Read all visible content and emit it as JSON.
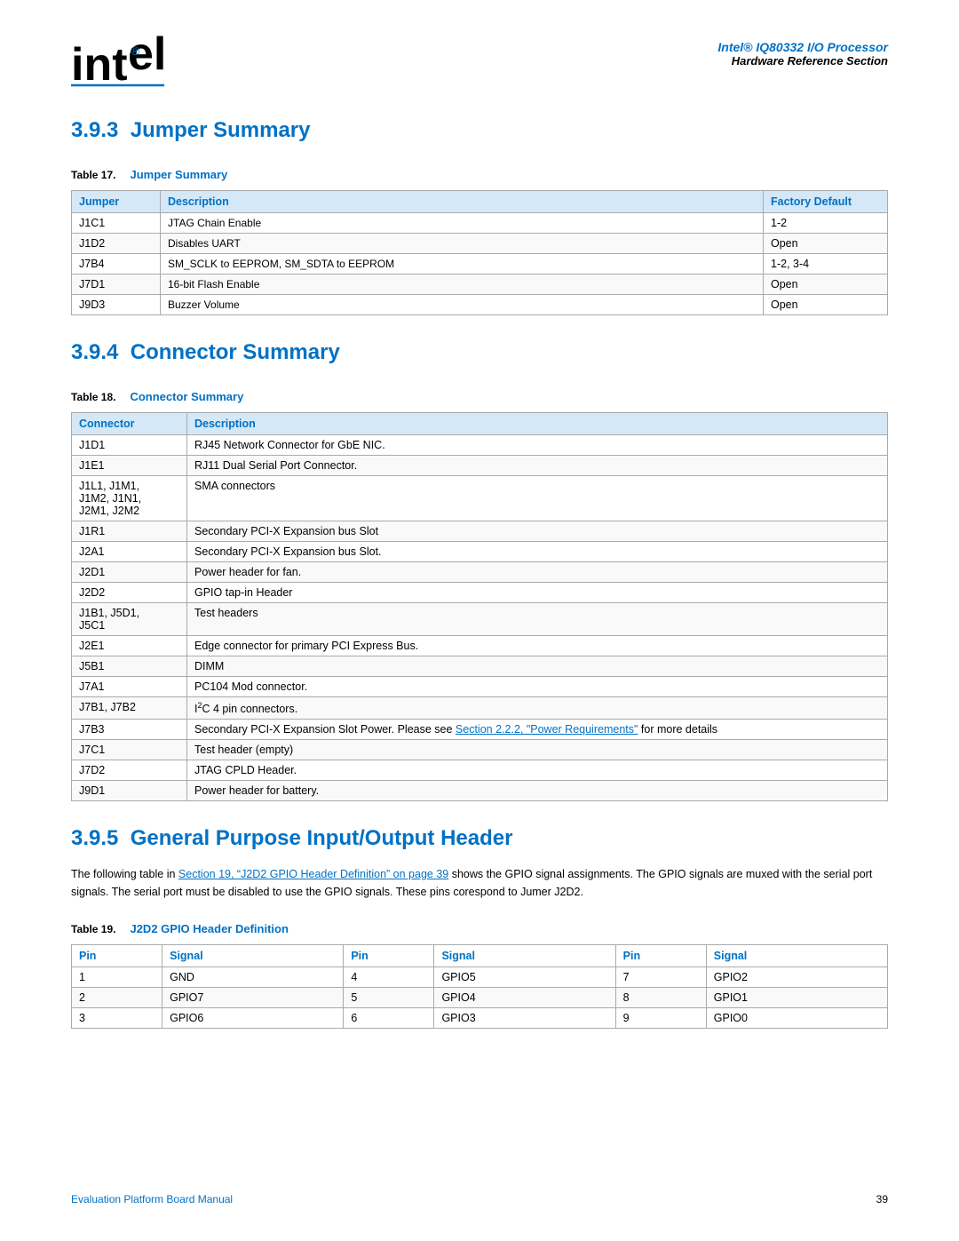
{
  "header": {
    "logo_text": "int",
    "logo_suffix": "el",
    "logo_dot": "®",
    "title_italic": "Intel® IQ80332 I/O Processor",
    "title_sub": "Hardware Reference Section"
  },
  "section393": {
    "heading": "3.9.3",
    "title": "Jumper Summary",
    "table_label": "Table 17.",
    "table_title": "Jumper Summary",
    "columns": [
      "Jumper",
      "Description",
      "Factory Default"
    ],
    "rows": [
      [
        "J1C1",
        "JTAG Chain Enable",
        "1-2"
      ],
      [
        "J1D2",
        "Disables UART",
        "Open"
      ],
      [
        "J7B4",
        "SM_SCLK to EEPROM, SM_SDTA to EEPROM",
        "1-2, 3-4"
      ],
      [
        "J7D1",
        "16-bit Flash Enable",
        "Open"
      ],
      [
        "J9D3",
        "Buzzer Volume",
        "Open"
      ]
    ]
  },
  "section394": {
    "heading": "3.9.4",
    "title": "Connector Summary",
    "table_label": "Table 18.",
    "table_title": "Connector Summary",
    "columns": [
      "Connector",
      "Description"
    ],
    "rows": [
      {
        "connector": "J1D1",
        "desc": "RJ45 Network Connector for GbE NIC.",
        "link": false
      },
      {
        "connector": "J1E1",
        "desc": "RJ11 Dual Serial Port Connector.",
        "link": false
      },
      {
        "connector": "J1L1, J1M1,\nJ1M2, J1N1,\nJ2M1, J2M2",
        "desc": "SMA connectors",
        "link": false
      },
      {
        "connector": "J1R1",
        "desc": "Secondary PCI-X Expansion bus Slot",
        "link": false
      },
      {
        "connector": "J2A1",
        "desc": "Secondary PCI-X Expansion bus Slot.",
        "link": false
      },
      {
        "connector": "J2D1",
        "desc": "Power header for fan.",
        "link": false
      },
      {
        "connector": "J2D2",
        "desc": "GPIO tap-in Header",
        "link": false
      },
      {
        "connector": "J1B1, J5D1,\nJ5C1",
        "desc": "Test headers",
        "link": false
      },
      {
        "connector": "J2E1",
        "desc": "Edge connector for primary PCI Express Bus.",
        "link": false
      },
      {
        "connector": "J5B1",
        "desc": "DIMM",
        "link": false
      },
      {
        "connector": "J7A1",
        "desc": "PC104 Mod connector.",
        "link": false
      },
      {
        "connector": "J7B1, J7B2",
        "desc": "I2C 4 pin connectors.",
        "link": false
      },
      {
        "connector": "J7B3",
        "desc_before": "Secondary PCI-X Expansion Slot Power. Please see ",
        "link_text": "Section 2.2.2, \"Power Requirements\"",
        "desc_after": "\nfor more details",
        "link": true
      },
      {
        "connector": "J7C1",
        "desc": "Test header (empty)",
        "link": false
      },
      {
        "connector": "J7D2",
        "desc": "JTAG CPLD Header.",
        "link": false
      },
      {
        "connector": "J9D1",
        "desc": "Power header for battery.",
        "link": false
      }
    ]
  },
  "section395": {
    "heading": "3.9.5",
    "title": "General Purpose Input/Output Header",
    "body_text_before": "The following table in ",
    "body_link": "Section 19, “J2D2 GPIO Header Definition” on page 39",
    "body_text_after": " shows the GPIO signal assignments. The GPIO signals are muxed with the serial port signals. The serial port must be disabled to use the GPIO signals. These pins corespond to Jumer J2D2.",
    "table_label": "Table 19.",
    "table_title": "J2D2 GPIO Header Definition",
    "columns": [
      "Pin",
      "Signal",
      "Pin",
      "Signal",
      "Pin",
      "Signal"
    ],
    "rows": [
      [
        "1",
        "GND",
        "4",
        "GPIO5",
        "7",
        "GPIO2"
      ],
      [
        "2",
        "GPIO7",
        "5",
        "GPIO4",
        "8",
        "GPIO1"
      ],
      [
        "3",
        "GPIO6",
        "6",
        "GPIO3",
        "9",
        "GPIO0"
      ]
    ]
  },
  "footer": {
    "left_text": "Evaluation Platform Board Manual",
    "right_text": "39"
  }
}
